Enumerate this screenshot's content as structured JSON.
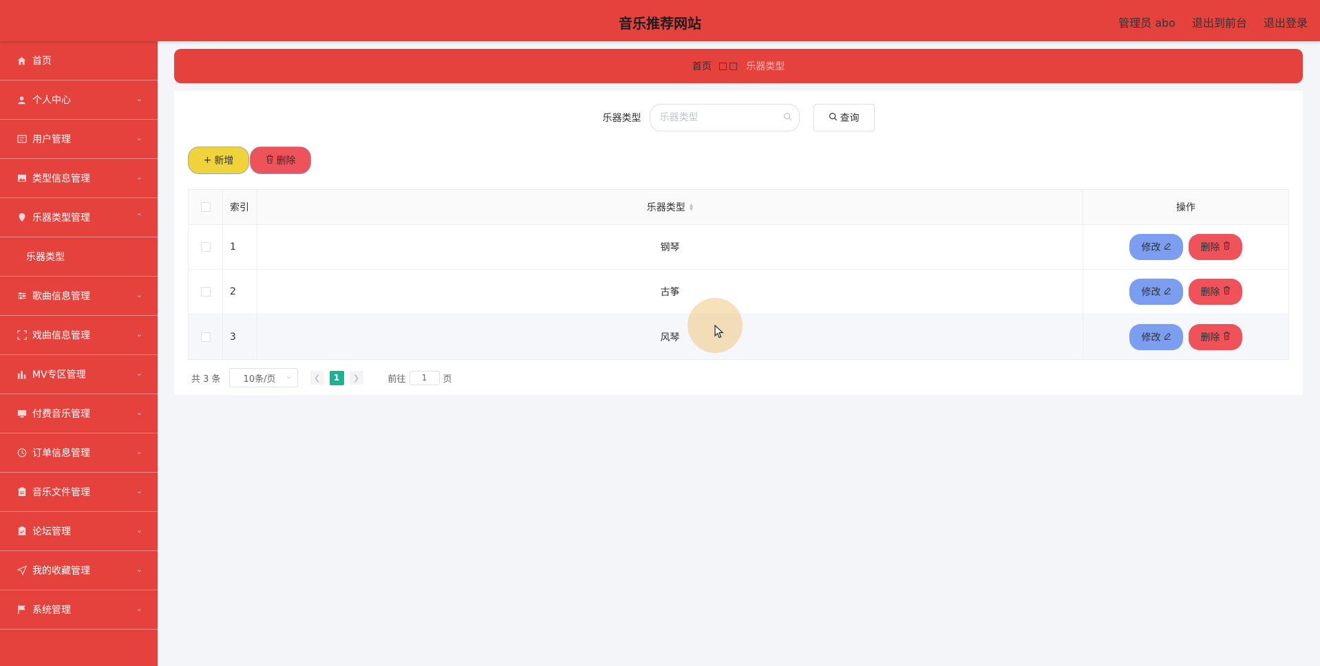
{
  "header": {
    "title": "音乐推荐网站",
    "user": "管理员 abo",
    "to_front": "退出到前台",
    "logout": "退出登录"
  },
  "sidebar": {
    "items": [
      {
        "label": "首页",
        "icon": "home-icon"
      },
      {
        "label": "个人中心",
        "icon": "user-icon"
      },
      {
        "label": "用户管理",
        "icon": "id-card-icon"
      },
      {
        "label": "类型信息管理",
        "icon": "picture-icon"
      },
      {
        "label": "乐器类型管理",
        "icon": "location-icon",
        "expanded": true
      },
      {
        "label": "歌曲信息管理",
        "icon": "sliders-icon"
      },
      {
        "label": "戏曲信息管理",
        "icon": "fullscreen-icon"
      },
      {
        "label": "MV专区管理",
        "icon": "bar-chart-icon"
      },
      {
        "label": "付费音乐管理",
        "icon": "monitor-icon"
      },
      {
        "label": "订单信息管理",
        "icon": "clock-icon"
      },
      {
        "label": "音乐文件管理",
        "icon": "clipboard-icon"
      },
      {
        "label": "论坛管理",
        "icon": "clipboard-check-icon"
      },
      {
        "label": "我的收藏管理",
        "icon": "send-icon"
      },
      {
        "label": "系统管理",
        "icon": "flag-icon"
      }
    ],
    "sub_item": "乐器类型"
  },
  "breadcrumb": {
    "home": "首页",
    "separator": "",
    "current": "乐器类型"
  },
  "search": {
    "label": "乐器类型",
    "placeholder": "乐器类型",
    "button": "查询"
  },
  "actions": {
    "add": "新增",
    "delete": "删除"
  },
  "table": {
    "headers": {
      "index": "索引",
      "type": "乐器类型",
      "ops": "操作"
    },
    "rows": [
      {
        "index": "1",
        "type": "钢琴"
      },
      {
        "index": "2",
        "type": "古筝"
      },
      {
        "index": "3",
        "type": "风琴"
      }
    ],
    "edit_label": "修改",
    "delete_label": "删除"
  },
  "pagination": {
    "total": "共 3 条",
    "page_size": "10条/页",
    "current_page": "1",
    "goto_label": "前往",
    "goto_value": "1",
    "page_suffix": "页"
  },
  "colors": {
    "primary": "#e5423e",
    "add_button": "#f0d33b",
    "delete_button": "#f0525a",
    "edit_button": "#7b9ef0",
    "page_active": "#1ab394"
  }
}
